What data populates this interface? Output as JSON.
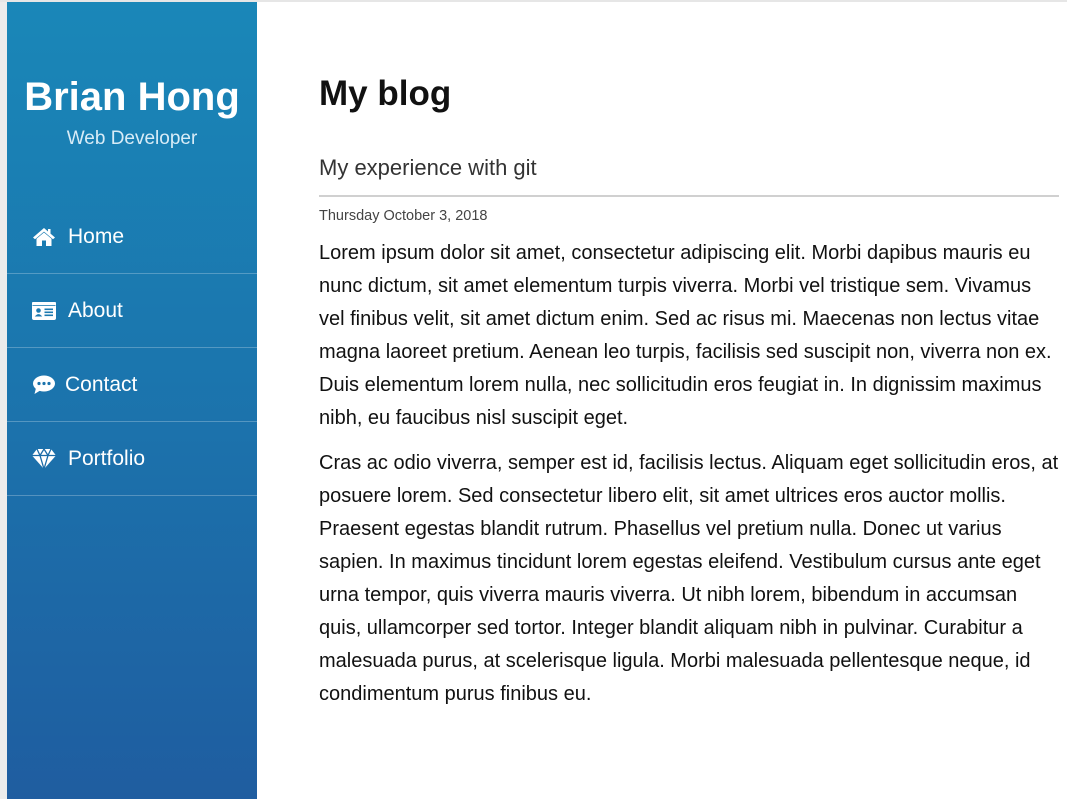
{
  "sidebar": {
    "name": "Brian Hong",
    "role": "Web Developer",
    "nav": [
      {
        "label": "Home",
        "icon": "home-icon"
      },
      {
        "label": "About",
        "icon": "id-card-icon"
      },
      {
        "label": "Contact",
        "icon": "chat-bubble-icon"
      },
      {
        "label": "Portfolio",
        "icon": "diamond-icon"
      }
    ],
    "colors": {
      "gradient_top": "#1a87b8",
      "gradient_bottom": "#1f5da0",
      "text": "#ffffff"
    }
  },
  "main": {
    "page_title": "My blog",
    "post": {
      "title": "My experience with git",
      "date": "Thursday October 3, 2018",
      "paragraphs": [
        "Lorem ipsum dolor sit amet, consectetur adipiscing elit. Morbi dapibus mauris eu nunc dictum, sit amet elementum turpis viverra. Morbi vel tristique sem. Vivamus vel finibus velit, sit amet dictum enim. Sed ac risus mi. Maecenas non lectus vitae magna laoreet pretium. Aenean leo turpis, facilisis sed suscipit non, viverra non ex. Duis elementum lorem nulla, nec sollicitudin eros feugiat in. In dignissim maximus nibh, eu faucibus nisl suscipit eget.",
        "Cras ac odio viverra, semper est id, facilisis lectus. Aliquam eget sollicitudin eros, at posuere lorem. Sed consectetur libero elit, sit amet ultrices eros auctor mollis. Praesent egestas blandit rutrum. Phasellus vel pretium nulla. Donec ut varius sapien. In maximus tincidunt lorem egestas eleifend. Vestibulum cursus ante eget urna tempor, quis viverra mauris viverra. Ut nibh lorem, bibendum in accumsan quis, ullamcorper sed tortor. Integer blandit aliquam nibh in pulvinar. Curabitur a malesuada purus, at scelerisque ligula. Morbi malesuada pellentesque neque, id condimentum purus finibus eu."
      ]
    }
  }
}
